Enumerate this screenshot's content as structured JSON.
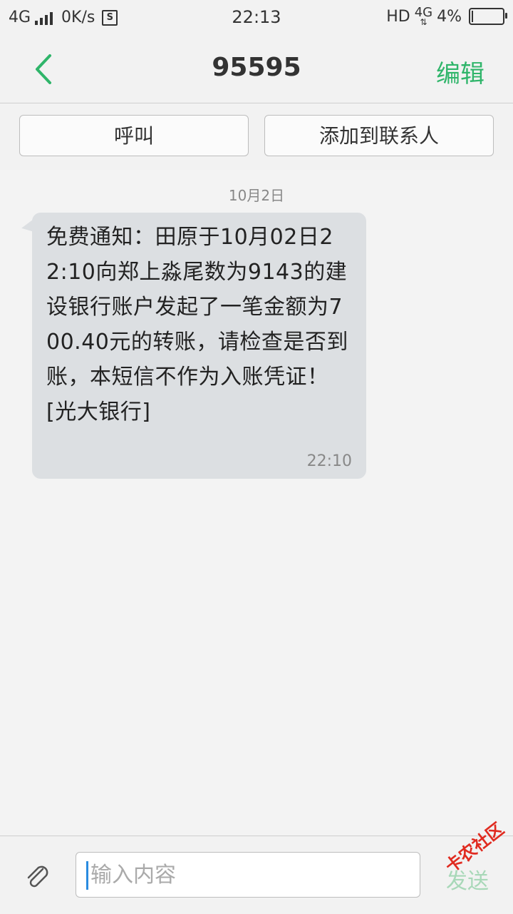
{
  "status_bar": {
    "network_left": "4G",
    "speed": "0K/s",
    "speed_icon_label": "S",
    "time": "22:13",
    "hd": "HD",
    "network_right": "4G",
    "battery": "4%",
    "battery_level": 0.04
  },
  "header": {
    "title": "95595",
    "edit_label": "编辑"
  },
  "actions": {
    "call_label": "呼叫",
    "add_contact_label": "添加到联系人"
  },
  "conversation": {
    "date": "10月2日",
    "messages": [
      {
        "text": "免费通知：田原于10月02日22:10向郑上淼尾数为9143的建设银行账户发起了一笔金额为700.40元的转账，请检查是否到账，本短信不作为入账凭证！[光大银行]",
        "time": "22:10"
      }
    ]
  },
  "input_bar": {
    "placeholder": "输入内容",
    "send_label": "发送",
    "watermark": "卡农社区"
  },
  "colors": {
    "accent": "#2fb56a",
    "bubble": "#dcdfe2",
    "background": "#f2f2f2",
    "watermark": "#e02b20"
  }
}
